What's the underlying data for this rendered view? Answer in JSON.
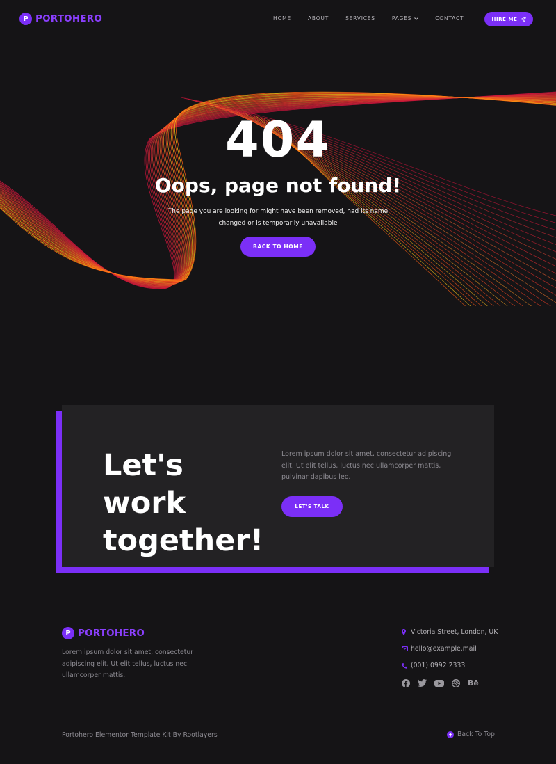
{
  "header": {
    "logo_letter": "P",
    "logo_text": "PORTOHERO",
    "nav": [
      "HOME",
      "ABOUT",
      "SERVICES",
      "PAGES",
      "CONTACT"
    ],
    "hire_label": "HIRE ME"
  },
  "hero": {
    "code": "404",
    "title": "Oops, page not found!",
    "description": "The page you are looking for might have been removed, had its name changed or is temporarily unavailable",
    "button": "BACK TO HOME"
  },
  "cta": {
    "title": "Let's work together!",
    "text": "Lorem ipsum dolor sit amet, consectetur adipiscing elit. Ut elit tellus, luctus nec ullamcorper mattis, pulvinar dapibus leo.",
    "button": "LET'S TALK"
  },
  "footer": {
    "logo_letter": "P",
    "logo_text": "PORTOHERO",
    "description": "Lorem ipsum dolor sit amet, consectetur adipiscing elit. Ut elit tellus, luctus nec ullamcorper mattis.",
    "address": "Victoria Street, London, UK",
    "email": "hello@example.mail",
    "phone": "(001) 0992 2333",
    "social": [
      "facebook-icon",
      "twitter-icon",
      "youtube-icon",
      "dribbble-icon",
      "behance-icon"
    ],
    "behance_text": "Bē",
    "copyright": "Portohero Elementor Template Kit By Rootlayers",
    "back_to_top": "Back To Top"
  },
  "colors": {
    "accent": "#7b2ff7",
    "background": "#151416",
    "panel": "#232224"
  }
}
